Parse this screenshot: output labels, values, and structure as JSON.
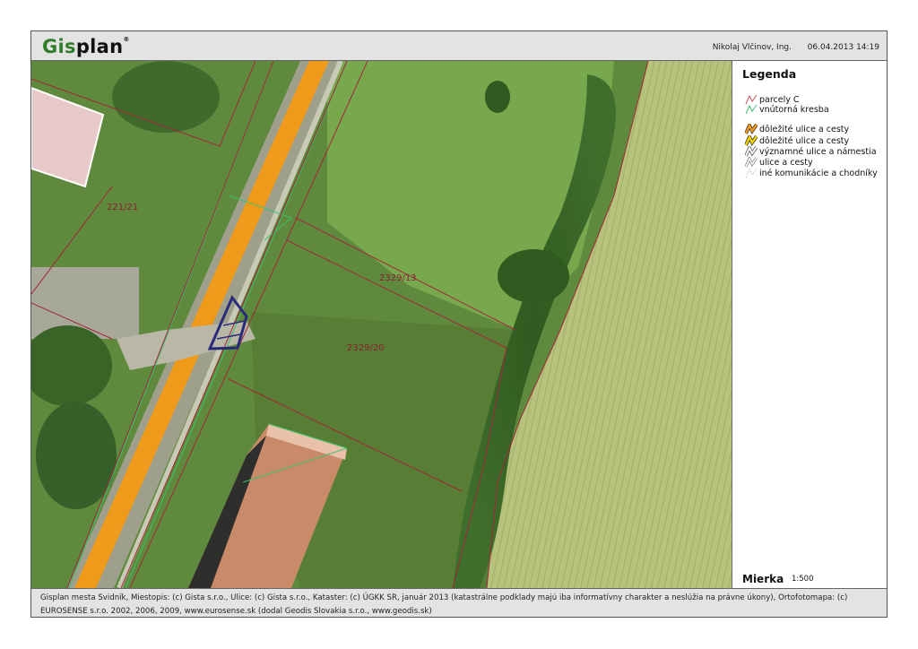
{
  "header": {
    "logo_text_a": "Gis",
    "logo_text_b": "plan",
    "logo_mark": "®",
    "user": "Nikolaj Vlčinov, Ing.",
    "datetime": "06.04.2013 14:19"
  },
  "map": {
    "parcel_labels": [
      "221/21",
      "2329/13",
      "2329/20"
    ],
    "colors": {
      "parcel_line": "#a0283a",
      "inner_line": "#3fbf6a",
      "main_road": "#f09a1c",
      "selection": "#2a2a7a"
    }
  },
  "legend": {
    "title": "Legenda",
    "items": [
      {
        "label": "parcely C",
        "icon": "parcel-line-icon",
        "color": "#c8505a"
      },
      {
        "label": "vnútorná kresba",
        "icon": "inner-drawing-icon",
        "color": "#3fbf6a"
      },
      {
        "label": "dôležité ulice a cesty",
        "icon": "important-road-orange-icon",
        "color": "#f09a1c"
      },
      {
        "label": "dôležité ulice a cesty",
        "icon": "important-road-yellow-icon",
        "color": "#f2d400"
      },
      {
        "label": "významné ulice a námestia",
        "icon": "major-street-icon",
        "color": "#ffffff"
      },
      {
        "label": "ulice a cesty",
        "icon": "street-icon",
        "color": "#ffffff"
      },
      {
        "label": "iné komunikácie a chodníky",
        "icon": "path-icon",
        "color": "#cccccc"
      }
    ],
    "scale_label": "Mierka",
    "scale_value": "1:500"
  },
  "footer": {
    "line1": "Gisplan mesta Svidník, Miestopis: (c) Gista s.r.o., Ulice: (c) Gista s.r.o., Kataster: (c) ÚGKK SR, január 2013 (katastrálne podklady majú iba informatívny charakter a neslúžia na právne úkony), Ortofotomapa: (c)",
    "line2": "EUROSENSE s.r.o. 2002, 2006, 2009, www.eurosense.sk (dodal Geodis Slovakia s.r.o., www.geodis.sk)"
  }
}
